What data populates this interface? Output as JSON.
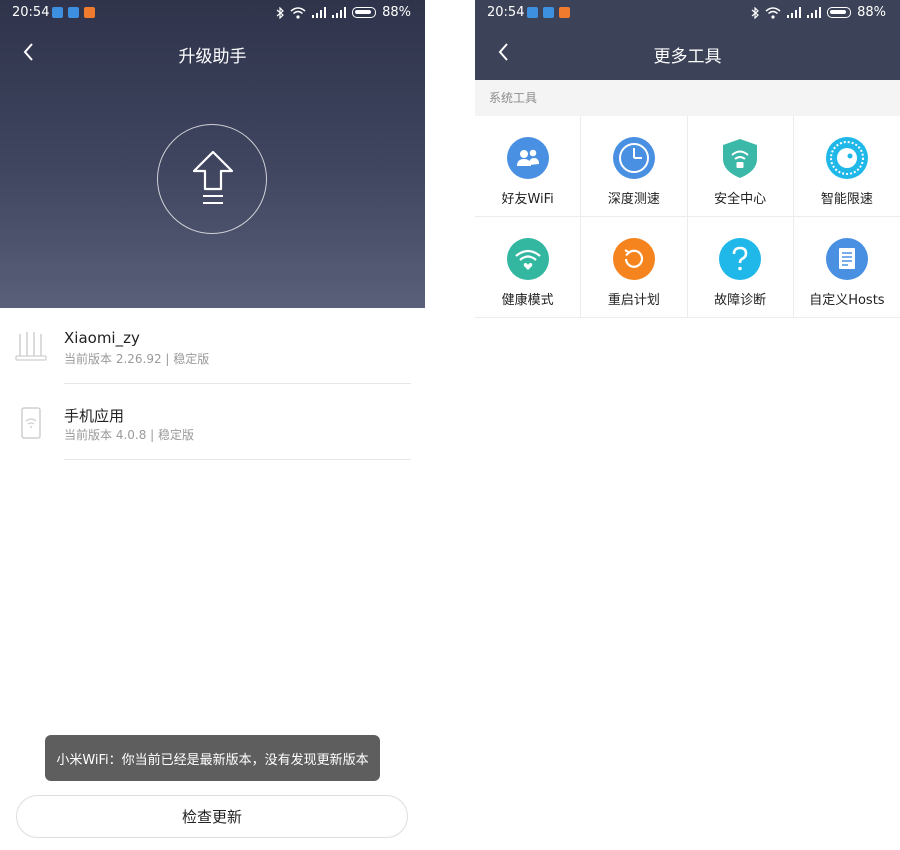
{
  "left": {
    "status": {
      "time": "20:54",
      "battery": "88%"
    },
    "title": "升级助手",
    "items": [
      {
        "name": "Xiaomi_zy",
        "sub": "当前版本 2.26.92 | 稳定版"
      },
      {
        "name": "手机应用",
        "sub": "当前版本 4.0.8 | 稳定版"
      }
    ],
    "toast": "小米WiFi：你当前已经是最新版本，没有发现更新版本",
    "check_button": "检查更新"
  },
  "right": {
    "status": {
      "time": "20:54",
      "battery": "88%"
    },
    "title": "更多工具",
    "section": "系统工具",
    "tools": [
      {
        "label": "好友WiFi",
        "icon": "friends-icon",
        "color": "#4a90e2"
      },
      {
        "label": "深度测速",
        "icon": "speed-dial-icon",
        "color": "#4a90e2"
      },
      {
        "label": "安全中心",
        "icon": "shield-icon",
        "color": "#3bb8a8"
      },
      {
        "label": "智能限速",
        "icon": "limit-dial-icon",
        "color": "#1fb8e8"
      },
      {
        "label": "健康模式",
        "icon": "health-wifi-icon",
        "color": "#34b7a0"
      },
      {
        "label": "重启计划",
        "icon": "reboot-timer-icon",
        "color": "#f5841f"
      },
      {
        "label": "故障诊断",
        "icon": "question-icon",
        "color": "#1fb8e8"
      },
      {
        "label": "自定义Hosts",
        "icon": "hosts-document-icon",
        "color": "#4a90e2"
      }
    ]
  }
}
